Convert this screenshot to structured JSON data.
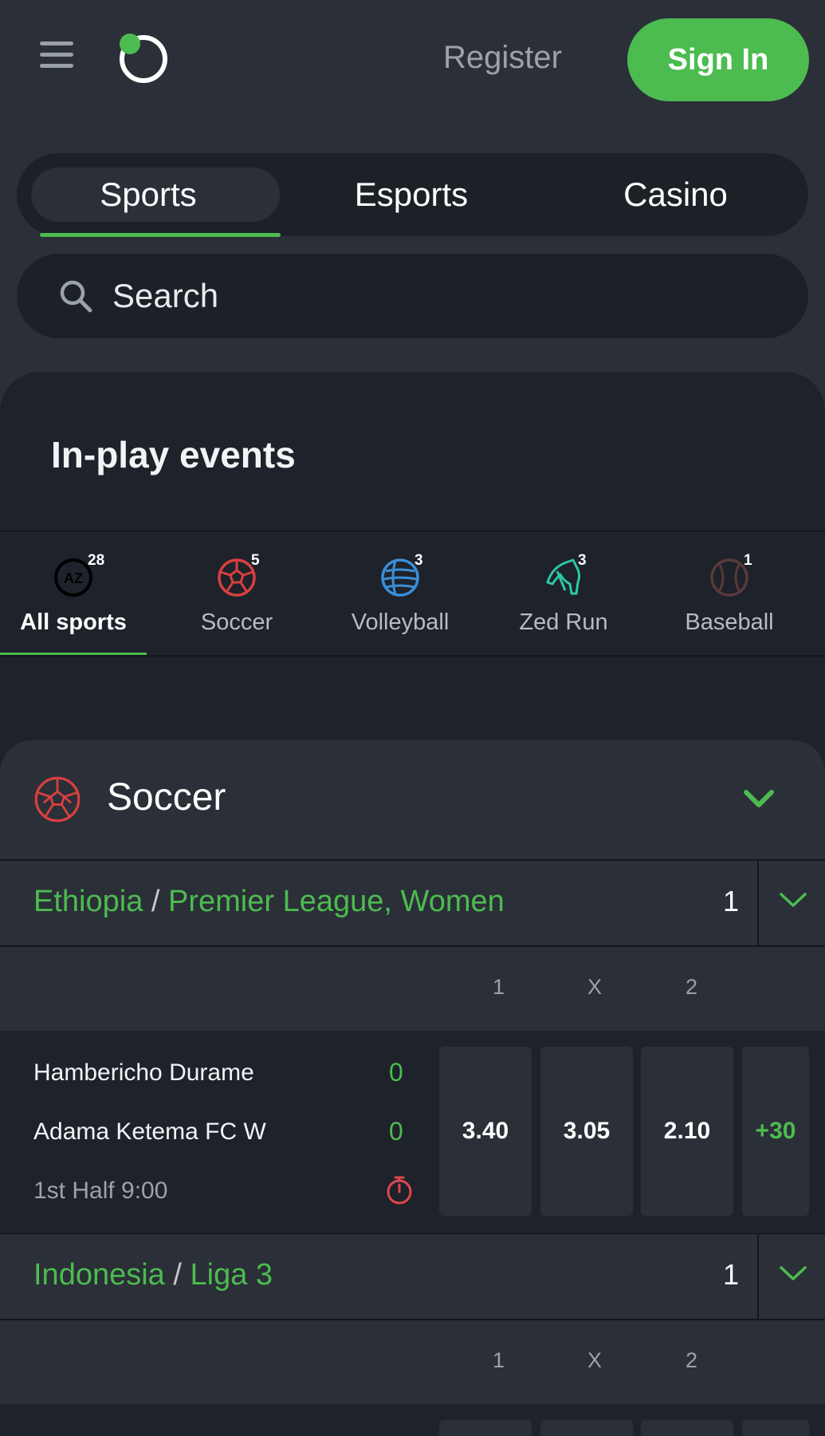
{
  "header": {
    "register_label": "Register",
    "signin_label": "Sign In"
  },
  "top_tabs": [
    {
      "label": "Sports",
      "active": true
    },
    {
      "label": "Esports",
      "active": false
    },
    {
      "label": "Casino",
      "active": false
    }
  ],
  "search": {
    "placeholder": "Search"
  },
  "inplay": {
    "title": "In-play events",
    "sports": [
      {
        "label": "All sports",
        "count": "28",
        "icon": "az-icon",
        "active": true
      },
      {
        "label": "Soccer",
        "count": "5",
        "icon": "soccer-ball-icon"
      },
      {
        "label": "Volleyball",
        "count": "3",
        "icon": "volleyball-icon"
      },
      {
        "label": "Zed Run",
        "count": "3",
        "icon": "horse-icon"
      },
      {
        "label": "Baseball",
        "count": "1",
        "icon": "baseball-icon"
      }
    ]
  },
  "soccer": {
    "title": "Soccer",
    "leagues": [
      {
        "country": "Ethiopia",
        "separator": "/",
        "league": "Premier League, Women",
        "count": "1",
        "odds_headers": [
          "1",
          "X",
          "2"
        ],
        "match": {
          "home": "Hambericho Durame",
          "away": "Adama Ketema FC W",
          "home_score": "0",
          "away_score": "0",
          "status": "1st Half 9:00",
          "odds": [
            "3.40",
            "3.05",
            "2.10"
          ],
          "more": "+30"
        }
      },
      {
        "country": "Indonesia",
        "separator": "/",
        "league": "Liga 3",
        "count": "1",
        "odds_headers": [
          "1",
          "X",
          "2"
        ]
      }
    ]
  },
  "colors": {
    "accent": "#4cbb50",
    "background": "#2b2f37",
    "panel": "#1e222a",
    "soccer_red": "#d84040",
    "volleyball_blue": "#3a8fd8",
    "zedrun_teal": "#2fc7a4"
  }
}
